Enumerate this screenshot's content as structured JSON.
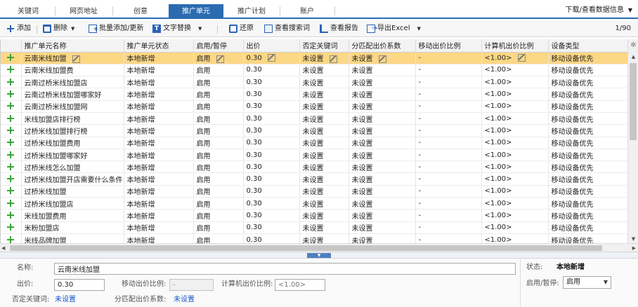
{
  "tabs": [
    "关键词",
    "网页地址",
    "创意",
    "推广单元",
    "推广计划",
    "账户"
  ],
  "active_tab": 3,
  "top_right": "下载/查看数据信息",
  "toolbar": {
    "add": "添加",
    "delete": "删除",
    "batch": "批量添加/更新",
    "replace": "文字替换",
    "restore": "还原",
    "search_words": "查看搜索词",
    "report": "查看报告",
    "export": "导出Excel",
    "pager": "1/90"
  },
  "columns": [
    "推广单元名称",
    "推广单元状态",
    "启用/暂停",
    "出价",
    "否定关键词",
    "分匹配出价系数",
    "移动出价比例",
    "计算机出价比例",
    "设备类型"
  ],
  "rows": [
    [
      "云南米线加盟",
      "本地新增",
      "启用",
      "0.30",
      "未设置",
      "未设置",
      "-",
      "<1.00>",
      "移动设备优先"
    ],
    [
      "云南米线加盟费",
      "本地新增",
      "启用",
      "0.30",
      "未设置",
      "未设置",
      "-",
      "<1.00>",
      "移动设备优先"
    ],
    [
      "云南过桥米线加盟店",
      "本地新增",
      "启用",
      "0.30",
      "未设置",
      "未设置",
      "-",
      "<1.00>",
      "移动设备优先"
    ],
    [
      "云南过桥米线加盟哪家好",
      "本地新增",
      "启用",
      "0.30",
      "未设置",
      "未设置",
      "-",
      "<1.00>",
      "移动设备优先"
    ],
    [
      "云南过桥米线加盟网",
      "本地新增",
      "启用",
      "0.30",
      "未设置",
      "未设置",
      "-",
      "<1.00>",
      "移动设备优先"
    ],
    [
      "米线加盟店排行榜",
      "本地新增",
      "启用",
      "0.30",
      "未设置",
      "未设置",
      "-",
      "<1.00>",
      "移动设备优先"
    ],
    [
      "过桥米线加盟排行榜",
      "本地新增",
      "启用",
      "0.30",
      "未设置",
      "未设置",
      "-",
      "<1.00>",
      "移动设备优先"
    ],
    [
      "过桥米线加盟费用",
      "本地新增",
      "启用",
      "0.30",
      "未设置",
      "未设置",
      "-",
      "<1.00>",
      "移动设备优先"
    ],
    [
      "过桥米线加盟哪家好",
      "本地新增",
      "启用",
      "0.30",
      "未设置",
      "未设置",
      "-",
      "<1.00>",
      "移动设备优先"
    ],
    [
      "过桥米线怎么加盟",
      "本地新增",
      "启用",
      "0.30",
      "未设置",
      "未设置",
      "-",
      "<1.00>",
      "移动设备优先"
    ],
    [
      "过桥米线加盟开店需要什么条件",
      "本地新增",
      "启用",
      "0.30",
      "未设置",
      "未设置",
      "-",
      "<1.00>",
      "移动设备优先"
    ],
    [
      "过桥米线加盟",
      "本地新增",
      "启用",
      "0.30",
      "未设置",
      "未设置",
      "-",
      "<1.00>",
      "移动设备优先"
    ],
    [
      "过桥米线加盟店",
      "本地新增",
      "启用",
      "0.30",
      "未设置",
      "未设置",
      "-",
      "<1.00>",
      "移动设备优先"
    ],
    [
      "米线加盟费用",
      "本地新增",
      "启用",
      "0.30",
      "未设置",
      "未设置",
      "-",
      "<1.00>",
      "移动设备优先"
    ],
    [
      "米粉加盟店",
      "本地新增",
      "启用",
      "0.30",
      "未设置",
      "未设置",
      "-",
      "<1.00>",
      "移动设备优先"
    ],
    [
      "米线品牌加盟",
      "本地新增",
      "启用",
      "0.30",
      "未设置",
      "未设置",
      "-",
      "<1.00>",
      "移动设备优先"
    ]
  ],
  "selected_row": 0,
  "detail": {
    "name_label": "名称:",
    "name_value": "云南米线加盟",
    "bid_label": "出价:",
    "bid_value": "0.30",
    "mobile_ratio_label": "移动出价比例:",
    "mobile_ratio_value": "-",
    "pc_ratio_label": "计算机出价比例:",
    "pc_ratio_placeholder": "<1.00>",
    "neg_kw_label": "否定关键词:",
    "neg_kw_value": "未设置",
    "match_label": "分匹配出价系数:",
    "match_value": "未设置",
    "status_label": "状态:",
    "status_value": "本地新增",
    "enable_label": "启用/暂停:",
    "enable_value": "启用"
  }
}
